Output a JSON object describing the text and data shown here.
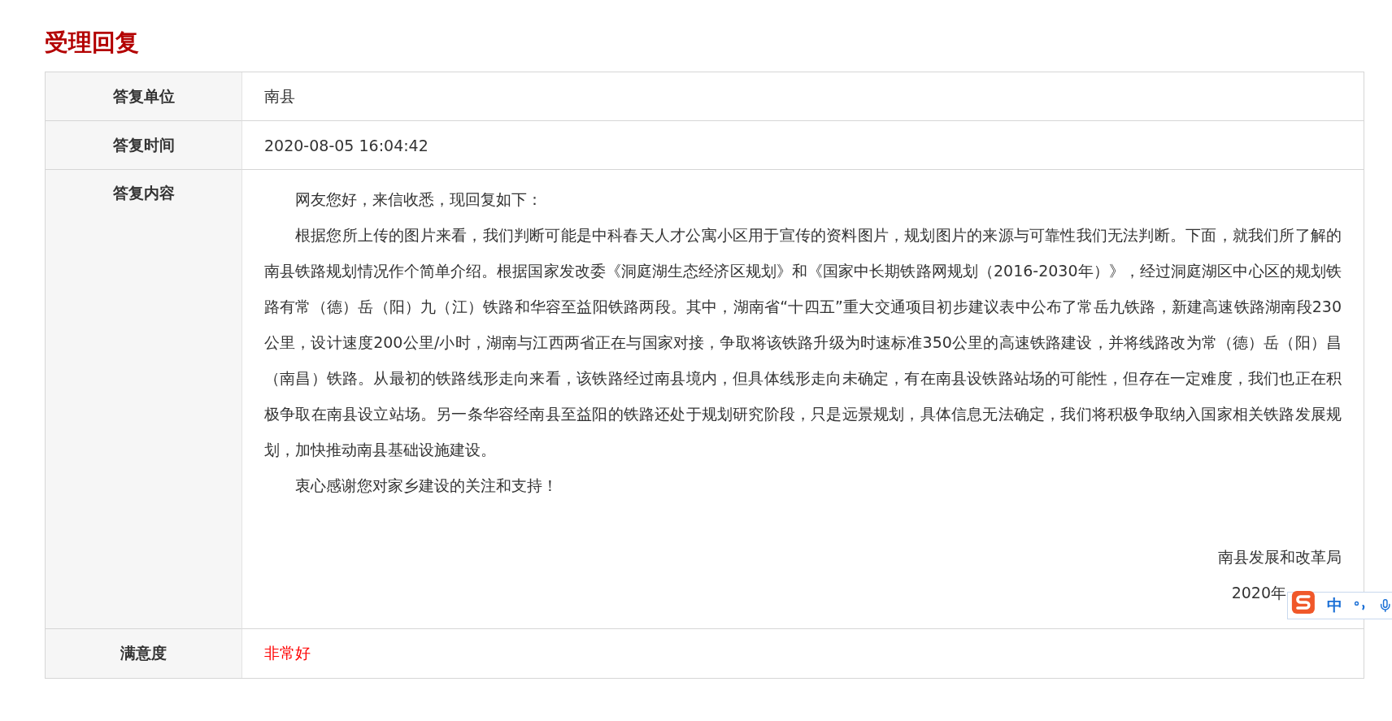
{
  "title": "受理回复",
  "rows": [
    {
      "kind": "text",
      "label": "答复单位",
      "value": "南县"
    },
    {
      "kind": "text",
      "label": "答复时间",
      "value": "2020-08-05 16:04:42"
    },
    {
      "kind": "letter",
      "label": "答复内容",
      "paragraphs": [
        "网友您好，来信收悉，现回复如下：",
        "根据您所上传的图片来看，我们判断可能是中科春天人才公寓小区用于宣传的资料图片，规划图片的来源与可靠性我们无法判断。下面，就我们所了解的南县铁路规划情况作个简单介绍。根据国家发改委《洞庭湖生态经济区规划》和《国家中长期铁路网规划（2016-2030年）》，经过洞庭湖区中心区的规划铁路有常（德）岳（阳）九（江）铁路和华容至益阳铁路两段。其中，湖南省“十四五”重大交通项目初步建议表中公布了常岳九铁路，新建高速铁路湖南段230公里，设计速度200公里/小时，湖南与江西两省正在与国家对接，争取将该铁路升级为时速标准350公里的高速铁路建设，并将线路改为常（德）岳（阳）昌（南昌）铁路。从最初的铁路线形走向来看，该铁路经过南县境内，但具体线形走向未确定，有在南县设铁路站场的可能性，但存在一定难度，我们也正在积极争取在南县设立站场。另一条华容经南县至益阳的铁路还处于规划研究阶段，只是远景规划，具体信息无法确定，我们将积极争取纳入国家相关铁路发展规划，加快推动南县基础设施建设。",
        "衷心感谢您对家乡建设的关注和支持！"
      ],
      "signature": "南县发展和改革局",
      "date": "2020年"
    },
    {
      "kind": "rating",
      "label": "满意度",
      "value": "非常好"
    }
  ],
  "ime_bar": {
    "mode": "中"
  }
}
